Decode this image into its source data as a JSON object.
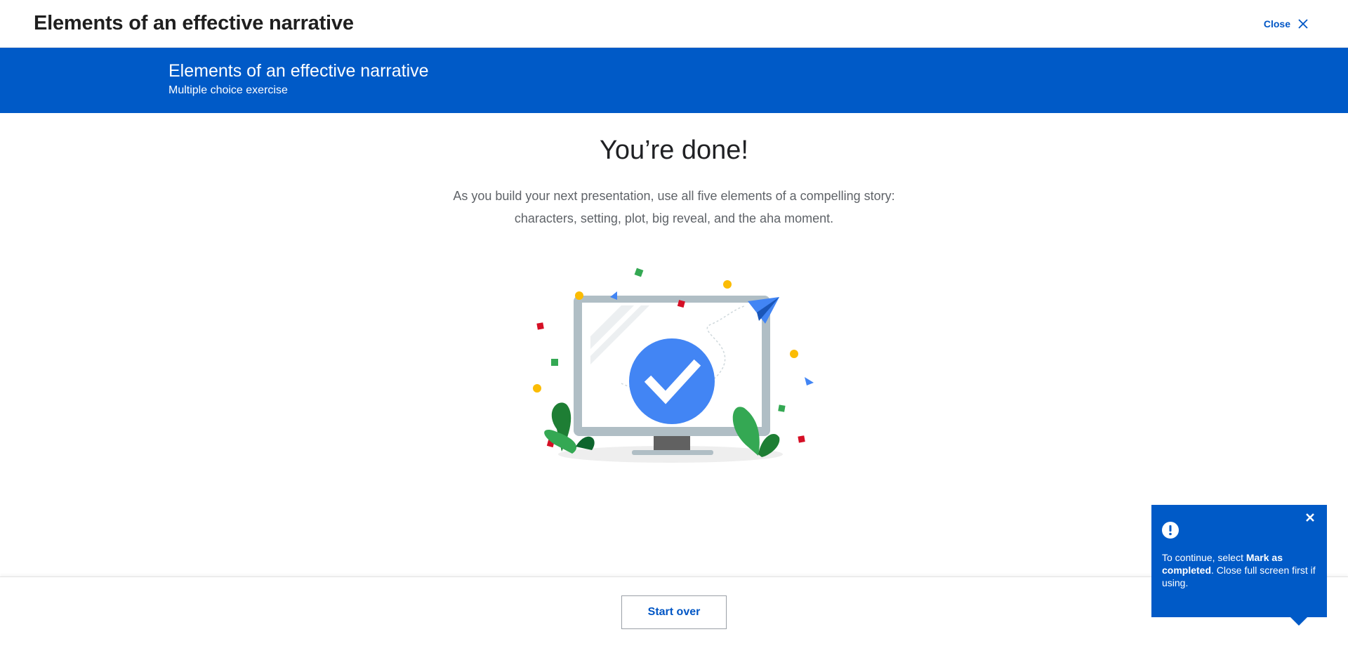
{
  "header": {
    "title": "Elements of an effective narrative",
    "close_label": "Close"
  },
  "banner": {
    "title": "Elements of an effective narrative",
    "subtitle": "Multiple choice exercise"
  },
  "main": {
    "heading": "You’re done!",
    "body_line1": "As you build your next presentation, use all five elements of a compelling story:",
    "body_line2": "characters, setting, plot, big reveal, and the aha moment."
  },
  "footer": {
    "start_over_label": "Start over"
  },
  "toast": {
    "prefix": "To continue, select ",
    "bold": "Mark as completed",
    "suffix": ". Close full screen first if using."
  },
  "colors": {
    "brand_blue": "#005ac7",
    "link_blue": "#0056c5",
    "check_blue": "#4285f4"
  },
  "icons": {
    "close": "close-icon",
    "toast_close": "close-icon",
    "alert": "alert-circle-icon",
    "illustration": "monitor-checkmark-celebration"
  }
}
